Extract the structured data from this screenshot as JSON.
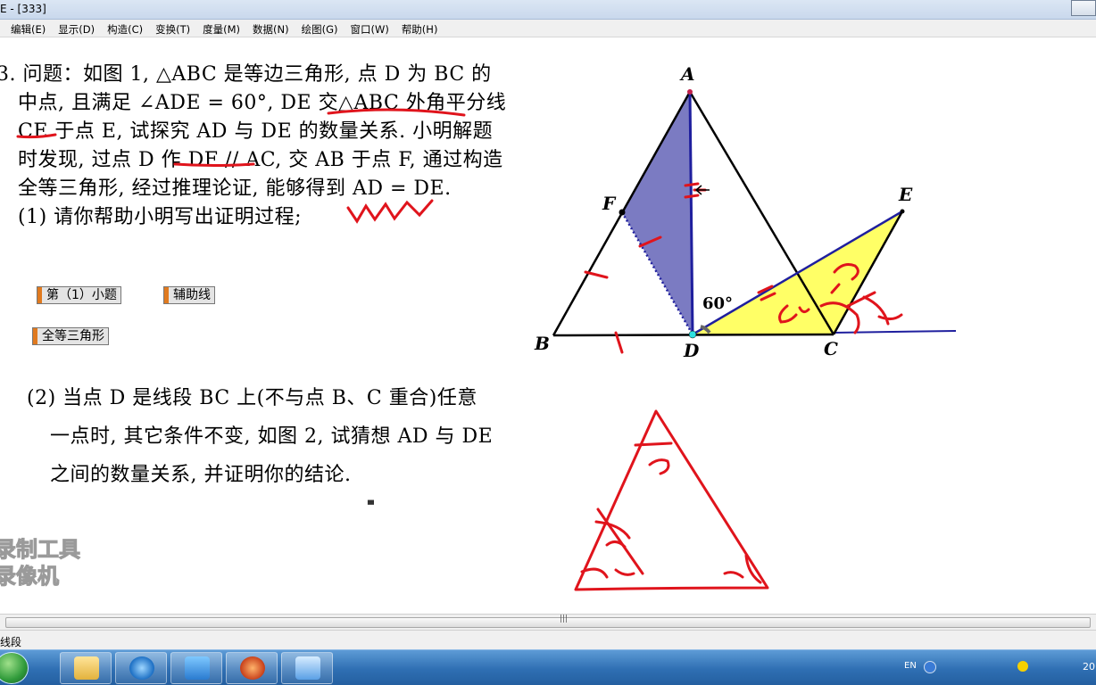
{
  "window": {
    "title": "E - [333]"
  },
  "menu": [
    "编辑(E)",
    "显示(D)",
    "构造(C)",
    "变换(T)",
    "度量(M)",
    "数据(N)",
    "绘图(G)",
    "窗口(W)",
    "帮助(H)"
  ],
  "problem": {
    "part1": [
      "3. 问题：如图 1, △ABC 是等边三角形, 点 D 为 BC 的",
      "中点, 且满足 ∠ADE = 60°, DE 交△ABC 外角平分线",
      "CE 于点 E, 试探究 AD 与 DE 的数量关系. 小明解题",
      "时发现, 过点 D 作 DF // AC, 交 AB 于点 F, 通过构造",
      "全等三角形, 经过推理论证, 能够得到 AD = DE.",
      "(1) 请你帮助小明写出证明过程;"
    ],
    "part2": [
      "(2) 当点 D 是线段 BC 上(不与点 B、C 重合)任意",
      "一点时, 其它条件不变, 如图 2, 试猜想 AD 与 DE",
      "之间的数量关系, 并证明你的结论."
    ]
  },
  "buttons": {
    "q1": "第（1）小题",
    "aux": "辅助线",
    "cong": "全等三角形"
  },
  "figure": {
    "labels": {
      "A": "A",
      "B": "B",
      "C": "C",
      "D": "D",
      "E": "E",
      "F": "F"
    },
    "angle_label": "60°"
  },
  "watermark": [
    "录制工具",
    "录像机"
  ],
  "status": {
    "text": "线段"
  },
  "tray": {
    "lang": "EN",
    "time": "20"
  },
  "colors": {
    "fill_blue": "#7b7bc2",
    "fill_yellow": "#ffff66",
    "ink_red": "#e0141c",
    "line_blue": "#1f1f9e"
  }
}
